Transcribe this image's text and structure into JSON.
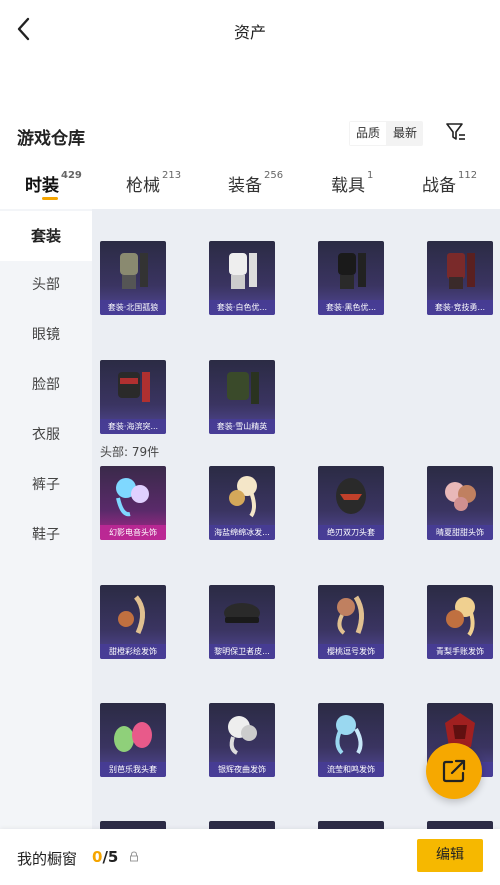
{
  "header": {
    "title": "资产"
  },
  "warehouse": {
    "title": "游戏仓库",
    "sort_options": [
      "品质",
      "最新"
    ],
    "sort_active": 0
  },
  "tabs": [
    {
      "label": "时装",
      "count": "429"
    },
    {
      "label": "枪械",
      "count": "213"
    },
    {
      "label": "装备",
      "count": "256"
    },
    {
      "label": "载具",
      "count": "1"
    },
    {
      "label": "战备",
      "count": "112"
    }
  ],
  "sidebar": [
    "套装",
    "头部",
    "眼镜",
    "脸部",
    "衣服",
    "裤子",
    "鞋子"
  ],
  "sections": {
    "suits": [
      "套装·北国孤狼",
      "套装·白色优...",
      "套装·黑色优...",
      "套装·竞技勇...",
      "套装·海滨突...",
      "套装·雪山精英"
    ],
    "head_label": "头部: 79件",
    "head": [
      "幻影电音头饰",
      "海盐绵绵冰发...",
      "绝刃双刀头套",
      "晴夏甜甜头饰",
      "甜橙彩绘发饰",
      "黎明保卫者皮...",
      "樱桃逗号发饰",
      "青梨手账发饰",
      "别芭乐我头套",
      "银辉夜曲发饰",
      "流莹和鸣发饰",
      ""
    ]
  },
  "bottom": {
    "label": "我的橱窗",
    "count_current": "0",
    "count_total": "/5",
    "edit_label": "编辑"
  },
  "colors": {
    "accent": "#f5a500",
    "card_bg": "#3a3461",
    "card_caption": "#463c96",
    "card_pink": "#b0288c"
  },
  "icons": [
    "back-arrow-icon",
    "filter-icon",
    "lock-icon",
    "share-icon"
  ]
}
